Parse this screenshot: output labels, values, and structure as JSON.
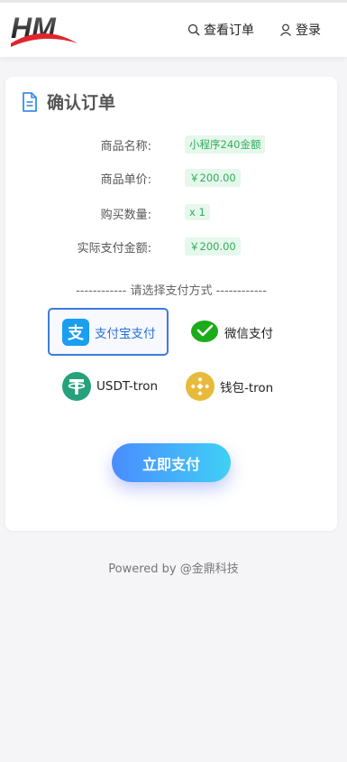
{
  "header": {
    "logo_text": "HM",
    "orders_label": "查看订单",
    "login_label": "登录"
  },
  "card": {
    "title": "确认订单",
    "fields": [
      {
        "label": "商品名称:",
        "value": "小程序240金额"
      },
      {
        "label": "商品单价:",
        "value": "￥200.00"
      },
      {
        "label": "购买数量:",
        "value": "x 1"
      },
      {
        "label": "实际支付金额:",
        "value": "￥200.00"
      }
    ],
    "divider_text": "------------  请选择支付方式  ------------",
    "payment_methods": [
      {
        "label": "支付宝支付",
        "icon": "alipay-icon",
        "selected": true
      },
      {
        "label": "微信支付",
        "icon": "wechat-pay-icon",
        "selected": false
      },
      {
        "label": "USDT-tron",
        "icon": "tether-icon",
        "selected": false
      },
      {
        "label": "钱包-tron",
        "icon": "binance-icon",
        "selected": false
      }
    ],
    "pay_button_label": "立即支付"
  },
  "footer": {
    "text": "Powered by @金鼎科技"
  },
  "colors": {
    "accent": "#3b7be0",
    "tag_bg": "#e6f7ec",
    "tag_text": "#2fae5c",
    "alipay": "#1a9ef0",
    "wechat": "#1aad19",
    "tether": "#26a17b",
    "binance": "#f0b90b"
  }
}
